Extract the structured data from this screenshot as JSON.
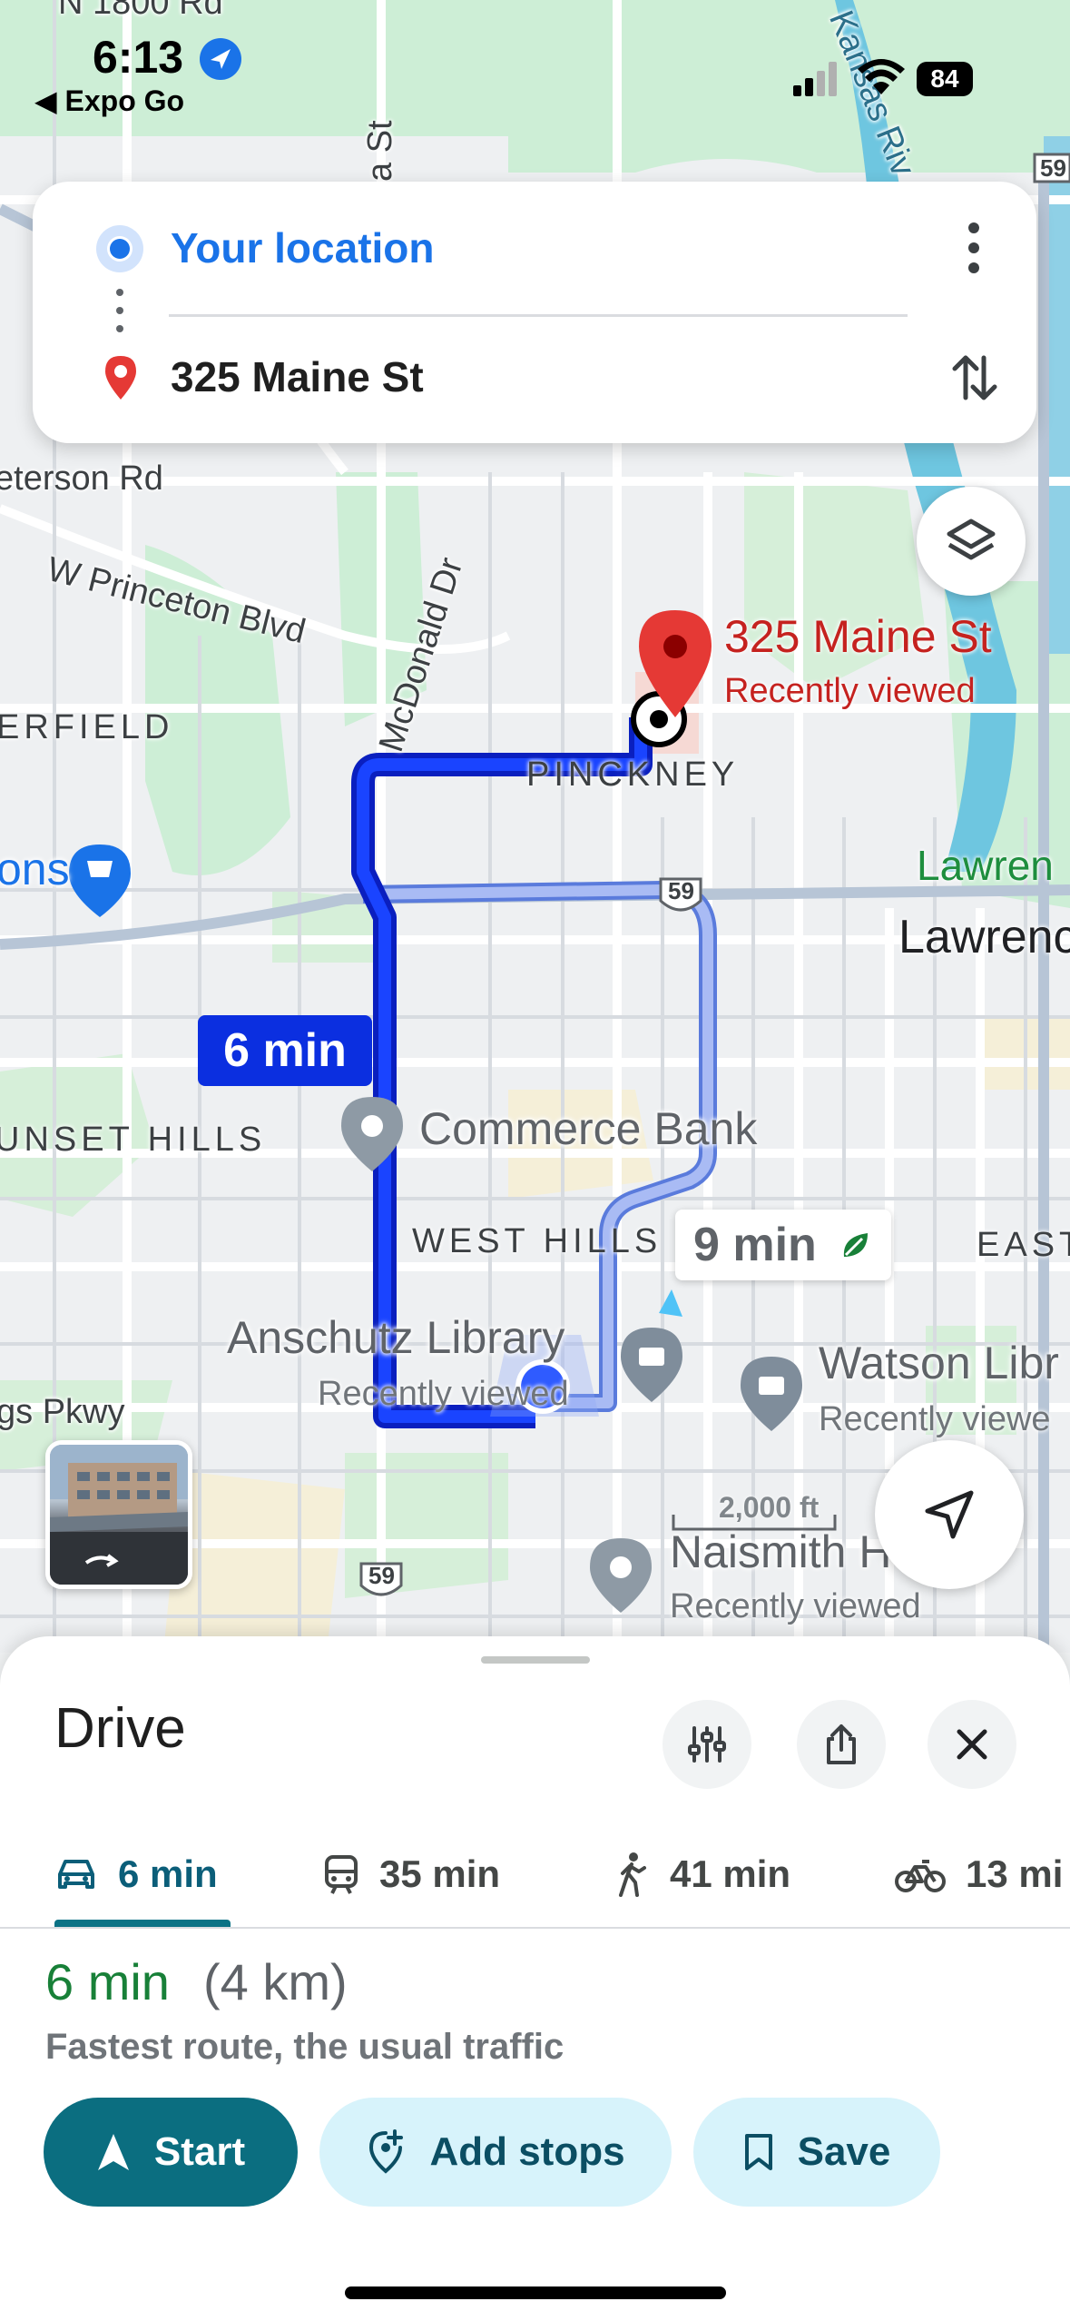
{
  "status_bar": {
    "time": "6:13",
    "back_app": "◀ Expo Go",
    "battery": "84"
  },
  "route_card": {
    "origin": "Your location",
    "destination": "325 Maine St"
  },
  "map": {
    "road_labels": [
      "N 1800 Rd",
      "eterson Rd",
      "W Princeton Blvd",
      "McDonald Dr",
      "gs Pkwy",
      "a St",
      "Kansas Riv"
    ],
    "area_labels": [
      "ERFIELD",
      "PINCKNEY",
      "UNSET HILLS",
      "WEST HILLS",
      "EAST"
    ],
    "city_labels": [
      "Lawrenc",
      "Lawren"
    ],
    "pois": [
      {
        "name": "Commerce Bank"
      },
      {
        "name": "Anschutz Library",
        "sub": "Recently viewed"
      },
      {
        "name": "Watson Libr",
        "sub": "Recently viewe"
      },
      {
        "name": "Naismith H",
        "sub": "Recently viewed"
      },
      {
        "name": "ons"
      }
    ],
    "destination_pin": {
      "name": "325 Maine St",
      "sub": "Recently viewed"
    },
    "highway_shields": [
      "59",
      "59",
      "59"
    ],
    "scale": "2,000 ft",
    "primary_route_time": "6 min",
    "alt_route_time": "9 min"
  },
  "sheet": {
    "title": "Drive",
    "modes": [
      {
        "label": "6 min",
        "mode": "drive",
        "selected": true
      },
      {
        "label": "35 min",
        "mode": "transit"
      },
      {
        "label": "41 min",
        "mode": "walk"
      },
      {
        "label": "13 mi",
        "mode": "bike"
      }
    ],
    "route_time": "6 min",
    "route_distance": "(4 km)",
    "route_desc": "Fastest route, the usual traffic",
    "buttons": {
      "start": "Start",
      "add_stops": "Add stops",
      "save": "Save"
    }
  },
  "colors": {
    "primary_route": "#0b2fe0",
    "alt_route": "#8fa6f0",
    "destination": "#c5221f",
    "accent": "#0b6e80"
  }
}
